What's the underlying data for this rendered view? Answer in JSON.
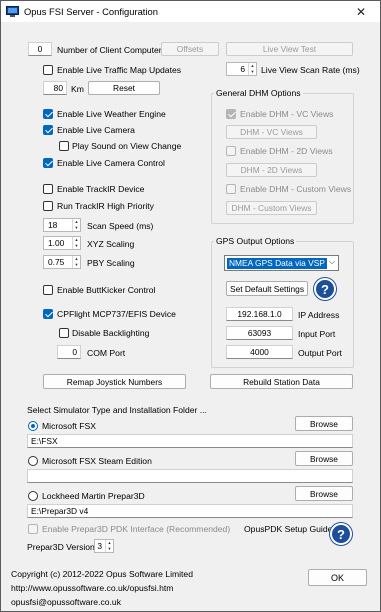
{
  "window": {
    "title": "Opus FSI Server - Configuration",
    "close_glyph": "✕"
  },
  "top": {
    "num_clients_value": "0",
    "num_clients_label": "Number of Client Computers",
    "offsets_button": "Offsets",
    "live_view_test_button": "Live View Test",
    "live_traffic_label": "Enable Live Traffic Map Updates",
    "scan_rate_value": "6",
    "scan_rate_label": "Live View Scan Rate (ms)",
    "km_value": "80",
    "km_label": "Km",
    "reset_button": "Reset"
  },
  "left": {
    "weather_label": "Enable Live Weather Engine",
    "camera_label": "Enable Live Camera",
    "play_sound_label": "Play Sound on View Change",
    "camera_control_label": "Enable Live Camera Control",
    "trackir_label": "Enable TrackIR Device",
    "trackir_priority_label": "Run TrackIR High Priority",
    "scan_speed_value": "18",
    "scan_speed_label": "Scan Speed (ms)",
    "xyz_value": "1.00",
    "xyz_label": "XYZ Scaling",
    "pby_value": "0.75",
    "pby_label": "PBY Scaling",
    "buttkicker_label": "Enable ButtKicker Control",
    "cpflight_label": "CPFlight MCP737/EFIS Device",
    "disable_backlight_label": "Disable Backlighting",
    "com_port_value": "0",
    "com_port_label": "COM Port"
  },
  "dhm": {
    "group_title": "General DHM Options",
    "vc_check_label": "Enable DHM - VC Views",
    "vc_button": "DHM - VC Views",
    "twod_check_label": "Enable DHM - 2D Views",
    "twod_button": "DHM - 2D Views",
    "custom_check_label": "Enable DHM - Custom Views",
    "custom_button": "DHM - Custom Views"
  },
  "gps": {
    "group_title": "GPS Output Options",
    "selected_option": "NMEA GPS Data via VSP",
    "default_settings_button": "Set Default Settings",
    "help_glyph": "?",
    "ip_value": "192.168.1.0",
    "ip_label": "IP Address",
    "input_port_value": "63093",
    "input_port_label": "Input Port",
    "output_port_value": "4000",
    "output_port_label": "Output Port"
  },
  "actions": {
    "remap_button": "Remap Joystick Numbers",
    "rebuild_button": "Rebuild Station Data"
  },
  "sim": {
    "section_label": "Select Simulator Type and Installation Folder ...",
    "browse_label": "Browse",
    "options": [
      {
        "label": "Microsoft FSX",
        "path": "E:\\FSX",
        "selected": true
      },
      {
        "label": "Microsoft FSX Steam Edition",
        "path": "",
        "selected": false
      },
      {
        "label": "Lockheed Martin Prepar3D",
        "path": "E:\\Prepar3D v4",
        "selected": false
      }
    ],
    "pdk_label": "Enable Prepar3D PDK Interface (Recommended)",
    "pdk_guide_label": "OpusPDK Setup Guide",
    "version_label": "Prepar3D Version",
    "version_value": "3"
  },
  "footer": {
    "copyright": "Copyright (c)  2012-2022 Opus Software Limited",
    "url": "http://www.opussoftware.co.uk/opusfsi.htm",
    "email": "opusfsi@opussoftware.co.uk",
    "ok_button": "OK"
  },
  "colors": {
    "accent": "#0067c0",
    "help_blue": "#1d4e9a",
    "window_bg": "#f0f0f0"
  }
}
